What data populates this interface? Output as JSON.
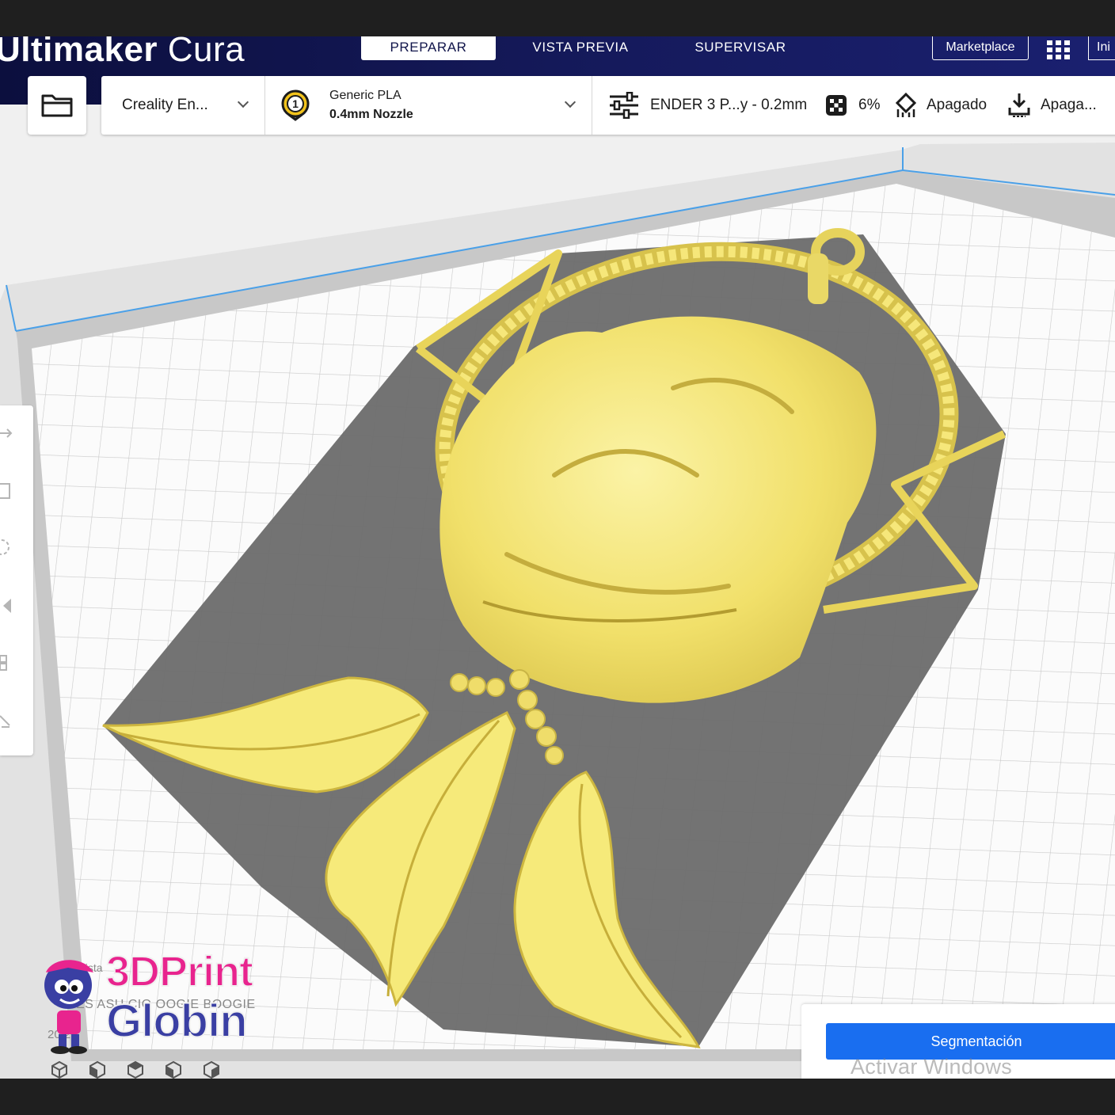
{
  "app": {
    "title_bold": "ltimaker",
    "title_light": " Cura",
    "title_prefix": "U"
  },
  "stages": {
    "prepare": "PREPARAR",
    "preview": "VISTA PREVIA",
    "monitor": "SUPERVISAR"
  },
  "header_right": {
    "marketplace": "Marketplace",
    "signin": "Ini"
  },
  "toolbar": {
    "printer": "Creality En...",
    "extruder_number": "1",
    "material": "Generic PLA",
    "nozzle": "0.4mm Nozzle",
    "profile": "ENDER 3 P...y - 0.2mm",
    "infill": "6%",
    "support": "Apagado",
    "adhesion": "Apaga..."
  },
  "object_list": {
    "label": "Lista",
    "filename": "ES      ASU  CIO  OOGIE BOOGIE",
    "dimensions": "20      20"
  },
  "watermark": {
    "line1": "3DPrint",
    "line2": "Globin"
  },
  "slice": {
    "button": "Segmentación"
  },
  "os_overlay": {
    "activate": "Activar Windows"
  },
  "colors": {
    "header_bg": "#10144a",
    "accent_blue": "#196ef0",
    "model_yellow": "#f3e56e",
    "shadow_grey": "#6a6a6a",
    "build_plate": "#f8f8f8"
  },
  "icons": {
    "open": "folder-icon",
    "extruder": "extruder-badge-icon",
    "profile": "sliders-icon",
    "infill": "infill-icon",
    "support": "support-icon",
    "adhesion": "adhesion-icon",
    "apps": "apps-grid-icon"
  }
}
